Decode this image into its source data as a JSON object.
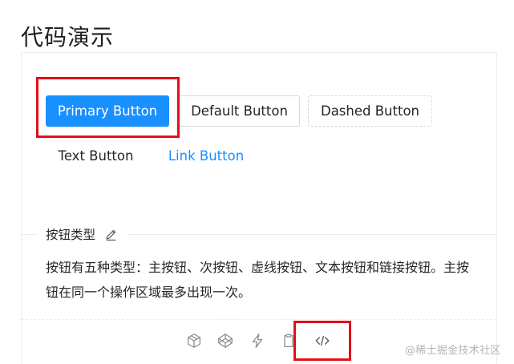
{
  "page": {
    "title": "代码演示"
  },
  "demo": {
    "buttons": {
      "primary": "Primary Button",
      "default": "Default Button",
      "dashed": "Dashed Button",
      "text": "Text Button",
      "link": "Link Button"
    }
  },
  "meta": {
    "title": "按钮类型",
    "description": "按钮有五种类型：主按钮、次按钮、虚线按钮、文本按钮和链接按钮。主按钮在同一个操作区域最多出现一次。"
  },
  "actions": [
    {
      "icon": "codesandbox-icon"
    },
    {
      "icon": "codepen-icon"
    },
    {
      "icon": "stackblitz-icon"
    },
    {
      "icon": "copy-icon"
    },
    {
      "icon": "code-expand-icon"
    }
  ],
  "watermark": "@稀土掘金技术社区",
  "colors": {
    "primary": "#1890ff",
    "annotation": "#e0101a"
  }
}
